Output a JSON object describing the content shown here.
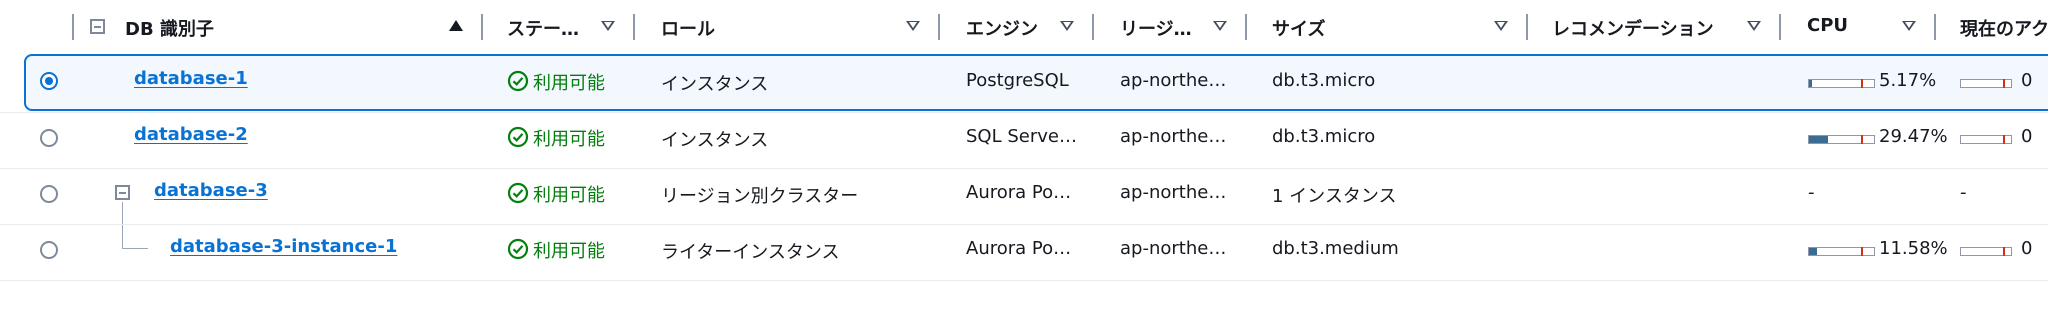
{
  "header": {
    "db_identifier": "DB 識別子",
    "status": "ステー…",
    "role": "ロール",
    "engine": "エンジン",
    "region": "リージ…",
    "size": "サイズ",
    "recommendation": "レコメンデーション",
    "cpu": "CPU",
    "current_activity": "現在のアク"
  },
  "rows": [
    {
      "name": "database-1",
      "status": "利用可能",
      "role": "インスタンス",
      "engine": "PostgreSQL",
      "region": "ap-northe…",
      "size": "db.t3.micro",
      "cpu": "5.17%",
      "cpu_fraction": 0.0517,
      "activity": "0",
      "selected": true
    },
    {
      "name": "database-2",
      "status": "利用可能",
      "role": "インスタンス",
      "engine": "SQL Serve…",
      "region": "ap-northe…",
      "size": "db.t3.micro",
      "cpu": "29.47%",
      "cpu_fraction": 0.2947,
      "activity": "0",
      "selected": false
    },
    {
      "name": "database-3",
      "status": "利用可能",
      "role": "リージョン別クラスター",
      "engine": "Aurora Po…",
      "region": "ap-northe…",
      "size": "1 インスタンス",
      "cpu": "-",
      "activity": "-",
      "selected": false
    },
    {
      "name": "database-3-instance-1",
      "status": "利用可能",
      "role": "ライターインスタンス",
      "engine": "Aurora Po…",
      "region": "ap-northe…",
      "size": "db.t3.medium",
      "cpu": "11.58%",
      "cpu_fraction": 0.1158,
      "activity": "0",
      "selected": false
    }
  ],
  "colors": {
    "link": "#0972d3",
    "status_available": "#037f0c",
    "selected_bg": "#f2f8fd",
    "bar_fill": "#3c6c92",
    "bar_marker": "#d13212"
  }
}
